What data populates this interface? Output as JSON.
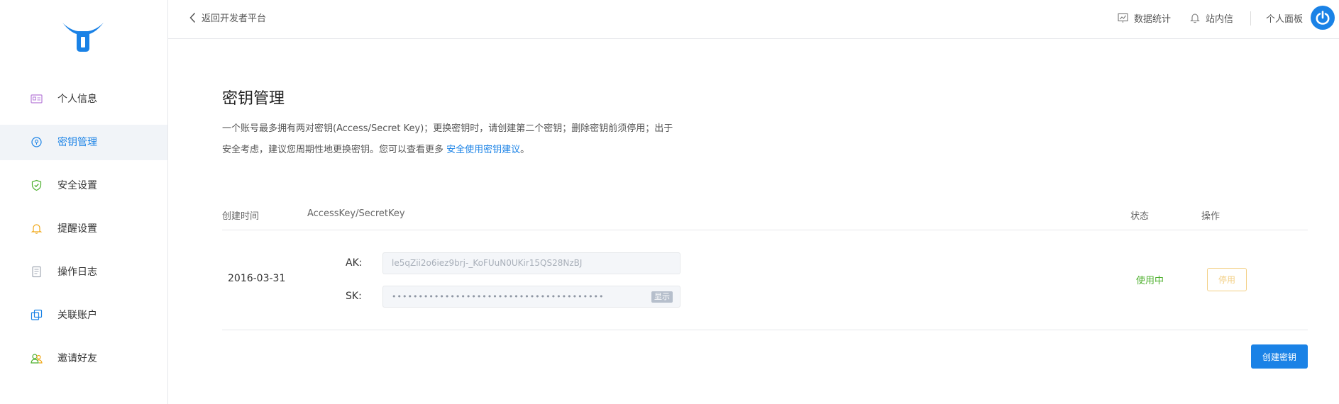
{
  "sidebar": {
    "items": [
      {
        "label": "个人信息",
        "icon": "id-card-icon",
        "active": false
      },
      {
        "label": "密钥管理",
        "icon": "key-icon",
        "active": true
      },
      {
        "label": "安全设置",
        "icon": "shield-icon",
        "active": false
      },
      {
        "label": "提醒设置",
        "icon": "bell-icon",
        "active": false
      },
      {
        "label": "操作日志",
        "icon": "log-icon",
        "active": false
      },
      {
        "label": "关联账户",
        "icon": "linked-accounts-icon",
        "active": false
      },
      {
        "label": "邀请好友",
        "icon": "invite-friends-icon",
        "active": false
      }
    ]
  },
  "header": {
    "back_label": "返回开发者平台",
    "stats_label": "数据统计",
    "messages_label": "站内信",
    "panel_label": "个人面板"
  },
  "main": {
    "title": "密钥管理",
    "desc_part1": "一个账号最多拥有两对密钥(Access/Secret Key)；更换密钥时，请创建第二个密钥；删除密钥前须停用；出于安全考虑，建议您周期性地更换密钥。您可以查看更多 ",
    "desc_link": "安全使用密钥建议",
    "desc_end": "。",
    "table": {
      "col_created": "创建时间",
      "col_keys": "AccessKey/SecretKey",
      "col_status": "状态",
      "col_action": "操作"
    },
    "row": {
      "created": "2016-03-31",
      "ak_label": "AK:",
      "ak_value": "le5qZii2o6iez9brj-_KoFUuN0UKir15QS28NzBJ",
      "sk_label": "SK:",
      "sk_value": "••••••••••••••••••••••••••••••••••••••••",
      "show_label": "显示",
      "status": "使用中",
      "disable_label": "停用"
    },
    "create_label": "创建密钥"
  },
  "colors": {
    "accent": "#1a82e6",
    "status_active": "#4caf2c",
    "warning_outline": "#f3cf84"
  }
}
